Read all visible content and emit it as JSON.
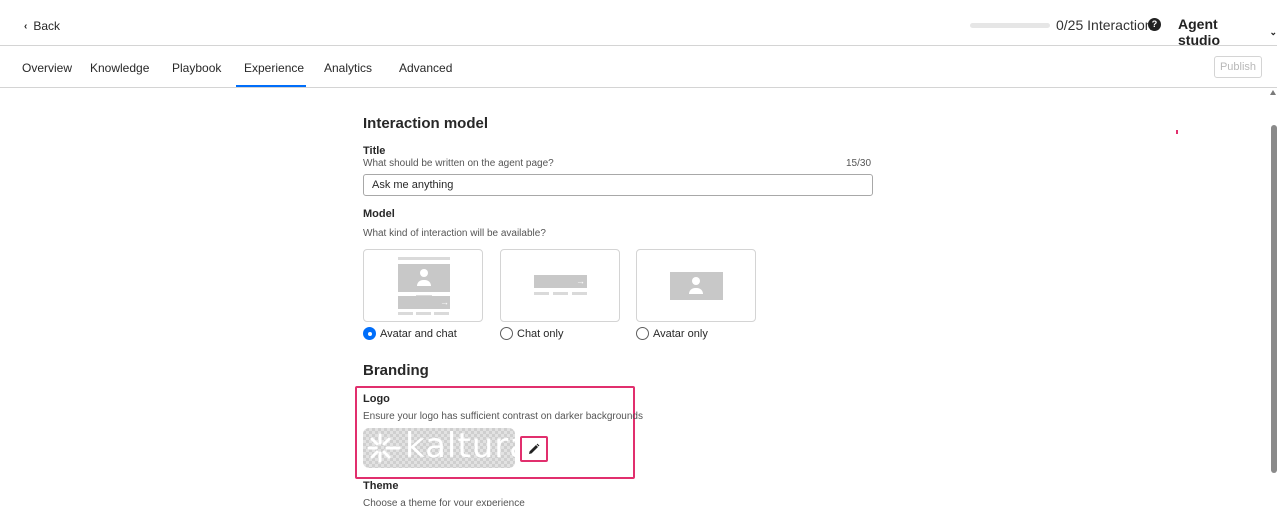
{
  "header": {
    "back_label": "Back",
    "interactions_text": "0/25 Interactions",
    "interactions_progress": 0,
    "help_icon": "question-circle-icon",
    "studio_label": "Agent studio"
  },
  "tabs": [
    {
      "label": "Overview"
    },
    {
      "label": "Knowledge"
    },
    {
      "label": "Playbook"
    },
    {
      "label": "Experience",
      "active": true
    },
    {
      "label": "Analytics"
    },
    {
      "label": "Advanced"
    }
  ],
  "publish_label": "Publish",
  "interaction_model": {
    "heading": "Interaction model",
    "title_label": "Title",
    "title_hint": "What should be written on the agent page?",
    "title_counter": "15/30",
    "title_value": "Ask me anything",
    "model_label": "Model",
    "model_hint": "What kind of interaction will be available?",
    "options": [
      {
        "label": "Avatar and chat",
        "selected": true
      },
      {
        "label": "Chat only",
        "selected": false
      },
      {
        "label": "Avatar only",
        "selected": false
      }
    ]
  },
  "branding": {
    "heading": "Branding",
    "logo_label": "Logo",
    "logo_hint": "Ensure your logo has sufficient contrast on darker backgrounds",
    "logo_text": "kaltura",
    "theme_label": "Theme",
    "theme_hint": "Choose a theme for your experience"
  },
  "colors": {
    "accent": "#006efa",
    "highlight": "#e12f6d"
  }
}
